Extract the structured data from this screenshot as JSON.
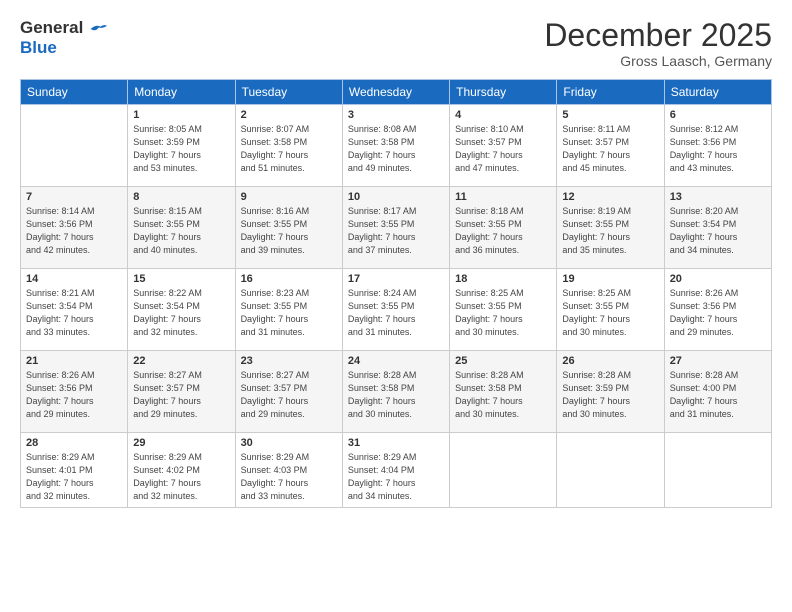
{
  "logo": {
    "general": "General",
    "blue": "Blue"
  },
  "header": {
    "month": "December 2025",
    "location": "Gross Laasch, Germany"
  },
  "days_of_week": [
    "Sunday",
    "Monday",
    "Tuesday",
    "Wednesday",
    "Thursday",
    "Friday",
    "Saturday"
  ],
  "weeks": [
    [
      {
        "day": "",
        "info": ""
      },
      {
        "day": "1",
        "info": "Sunrise: 8:05 AM\nSunset: 3:59 PM\nDaylight: 7 hours\nand 53 minutes."
      },
      {
        "day": "2",
        "info": "Sunrise: 8:07 AM\nSunset: 3:58 PM\nDaylight: 7 hours\nand 51 minutes."
      },
      {
        "day": "3",
        "info": "Sunrise: 8:08 AM\nSunset: 3:58 PM\nDaylight: 7 hours\nand 49 minutes."
      },
      {
        "day": "4",
        "info": "Sunrise: 8:10 AM\nSunset: 3:57 PM\nDaylight: 7 hours\nand 47 minutes."
      },
      {
        "day": "5",
        "info": "Sunrise: 8:11 AM\nSunset: 3:57 PM\nDaylight: 7 hours\nand 45 minutes."
      },
      {
        "day": "6",
        "info": "Sunrise: 8:12 AM\nSunset: 3:56 PM\nDaylight: 7 hours\nand 43 minutes."
      }
    ],
    [
      {
        "day": "7",
        "info": "Sunrise: 8:14 AM\nSunset: 3:56 PM\nDaylight: 7 hours\nand 42 minutes."
      },
      {
        "day": "8",
        "info": "Sunrise: 8:15 AM\nSunset: 3:55 PM\nDaylight: 7 hours\nand 40 minutes."
      },
      {
        "day": "9",
        "info": "Sunrise: 8:16 AM\nSunset: 3:55 PM\nDaylight: 7 hours\nand 39 minutes."
      },
      {
        "day": "10",
        "info": "Sunrise: 8:17 AM\nSunset: 3:55 PM\nDaylight: 7 hours\nand 37 minutes."
      },
      {
        "day": "11",
        "info": "Sunrise: 8:18 AM\nSunset: 3:55 PM\nDaylight: 7 hours\nand 36 minutes."
      },
      {
        "day": "12",
        "info": "Sunrise: 8:19 AM\nSunset: 3:55 PM\nDaylight: 7 hours\nand 35 minutes."
      },
      {
        "day": "13",
        "info": "Sunrise: 8:20 AM\nSunset: 3:54 PM\nDaylight: 7 hours\nand 34 minutes."
      }
    ],
    [
      {
        "day": "14",
        "info": "Sunrise: 8:21 AM\nSunset: 3:54 PM\nDaylight: 7 hours\nand 33 minutes."
      },
      {
        "day": "15",
        "info": "Sunrise: 8:22 AM\nSunset: 3:54 PM\nDaylight: 7 hours\nand 32 minutes."
      },
      {
        "day": "16",
        "info": "Sunrise: 8:23 AM\nSunset: 3:55 PM\nDaylight: 7 hours\nand 31 minutes."
      },
      {
        "day": "17",
        "info": "Sunrise: 8:24 AM\nSunset: 3:55 PM\nDaylight: 7 hours\nand 31 minutes."
      },
      {
        "day": "18",
        "info": "Sunrise: 8:25 AM\nSunset: 3:55 PM\nDaylight: 7 hours\nand 30 minutes."
      },
      {
        "day": "19",
        "info": "Sunrise: 8:25 AM\nSunset: 3:55 PM\nDaylight: 7 hours\nand 30 minutes."
      },
      {
        "day": "20",
        "info": "Sunrise: 8:26 AM\nSunset: 3:56 PM\nDaylight: 7 hours\nand 29 minutes."
      }
    ],
    [
      {
        "day": "21",
        "info": "Sunrise: 8:26 AM\nSunset: 3:56 PM\nDaylight: 7 hours\nand 29 minutes."
      },
      {
        "day": "22",
        "info": "Sunrise: 8:27 AM\nSunset: 3:57 PM\nDaylight: 7 hours\nand 29 minutes."
      },
      {
        "day": "23",
        "info": "Sunrise: 8:27 AM\nSunset: 3:57 PM\nDaylight: 7 hours\nand 29 minutes."
      },
      {
        "day": "24",
        "info": "Sunrise: 8:28 AM\nSunset: 3:58 PM\nDaylight: 7 hours\nand 30 minutes."
      },
      {
        "day": "25",
        "info": "Sunrise: 8:28 AM\nSunset: 3:58 PM\nDaylight: 7 hours\nand 30 minutes."
      },
      {
        "day": "26",
        "info": "Sunrise: 8:28 AM\nSunset: 3:59 PM\nDaylight: 7 hours\nand 30 minutes."
      },
      {
        "day": "27",
        "info": "Sunrise: 8:28 AM\nSunset: 4:00 PM\nDaylight: 7 hours\nand 31 minutes."
      }
    ],
    [
      {
        "day": "28",
        "info": "Sunrise: 8:29 AM\nSunset: 4:01 PM\nDaylight: 7 hours\nand 32 minutes."
      },
      {
        "day": "29",
        "info": "Sunrise: 8:29 AM\nSunset: 4:02 PM\nDaylight: 7 hours\nand 32 minutes."
      },
      {
        "day": "30",
        "info": "Sunrise: 8:29 AM\nSunset: 4:03 PM\nDaylight: 7 hours\nand 33 minutes."
      },
      {
        "day": "31",
        "info": "Sunrise: 8:29 AM\nSunset: 4:04 PM\nDaylight: 7 hours\nand 34 minutes."
      },
      {
        "day": "",
        "info": ""
      },
      {
        "day": "",
        "info": ""
      },
      {
        "day": "",
        "info": ""
      }
    ]
  ]
}
